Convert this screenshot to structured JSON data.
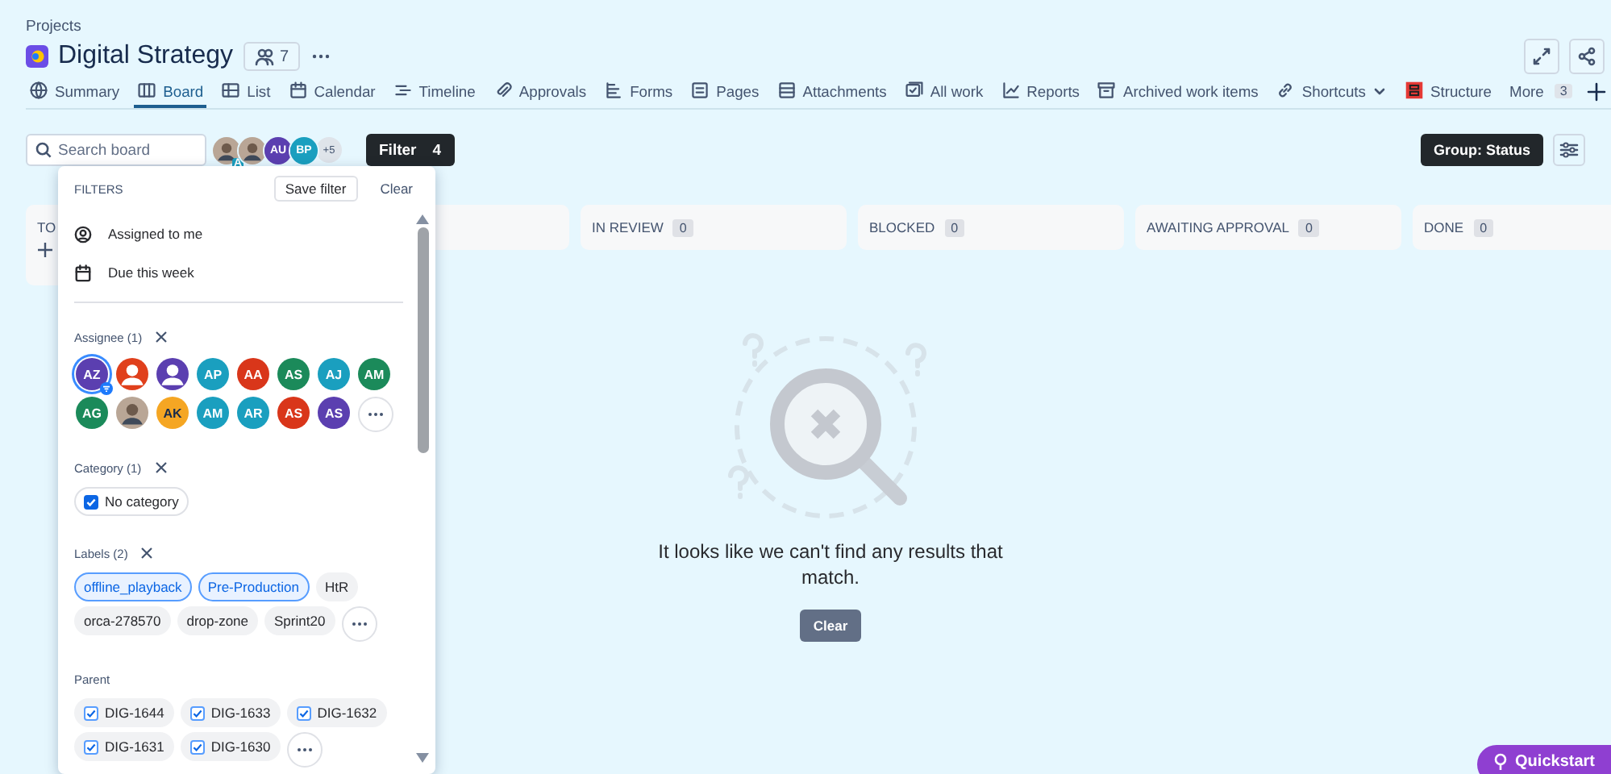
{
  "breadcrumb": "Projects",
  "project": {
    "title": "Digital Strategy",
    "members": "7"
  },
  "tabs": [
    {
      "label": "Summary",
      "selected": false
    },
    {
      "label": "Board",
      "selected": true
    },
    {
      "label": "List",
      "selected": false
    },
    {
      "label": "Calendar",
      "selected": false
    },
    {
      "label": "Timeline",
      "selected": false
    },
    {
      "label": "Approvals",
      "selected": false
    },
    {
      "label": "Forms",
      "selected": false
    },
    {
      "label": "Pages",
      "selected": false
    },
    {
      "label": "Attachments",
      "selected": false
    },
    {
      "label": "All work",
      "selected": false
    },
    {
      "label": "Reports",
      "selected": false
    },
    {
      "label": "Archived work items",
      "selected": false
    },
    {
      "label": "Shortcuts",
      "selected": false
    },
    {
      "label": "Structure",
      "selected": false
    },
    {
      "label": "More",
      "count": "3",
      "selected": false
    }
  ],
  "toolbar": {
    "search_placeholder": "Search board",
    "avatars": [
      {
        "kind": "photo",
        "badge": "A"
      },
      {
        "kind": "photo"
      },
      {
        "kind": "initials",
        "initials": "AU",
        "color": "#5b3fb0"
      },
      {
        "kind": "initials",
        "initials": "BP",
        "color": "#1a9fbf"
      }
    ],
    "more_avatars": "+5",
    "filter": {
      "label": "Filter",
      "count": "4"
    },
    "group_button": "Group: Status"
  },
  "columns": [
    {
      "label": "TO"
    },
    {
      "label": "IN REVIEW",
      "count": "0"
    },
    {
      "label": "BLOCKED",
      "count": "0"
    },
    {
      "label": "AWAITING APPROVAL",
      "count": "0"
    },
    {
      "label": "DONE",
      "count": "0"
    }
  ],
  "filters": {
    "title": "FILTERS",
    "save": "Save filter",
    "clear": "Clear",
    "quick": [
      {
        "label": "Assigned to me"
      },
      {
        "label": "Due this week"
      }
    ],
    "assignee": {
      "title": "Assignee (1)",
      "people": [
        {
          "kind": "initials",
          "initials": "AZ",
          "color": "#5b3fb0",
          "selected": true
        },
        {
          "kind": "silhouette",
          "color": "#e0401c",
          "selected": false
        },
        {
          "kind": "silhouette",
          "color": "#5b3fb0",
          "selected": false
        },
        {
          "kind": "initials",
          "initials": "AP",
          "color": "#1a9fbf",
          "selected": false
        },
        {
          "kind": "initials",
          "initials": "AA",
          "color": "#d9361a",
          "selected": false
        },
        {
          "kind": "initials",
          "initials": "AS",
          "color": "#1b8a5a",
          "selected": false
        },
        {
          "kind": "initials",
          "initials": "AJ",
          "color": "#1a9fbf",
          "selected": false
        },
        {
          "kind": "initials",
          "initials": "AM",
          "color": "#1b8a5a",
          "selected": false
        },
        {
          "kind": "initials",
          "initials": "AG",
          "color": "#1b8a5a",
          "selected": false
        },
        {
          "kind": "photo",
          "selected": false
        },
        {
          "kind": "initials",
          "initials": "AK",
          "color": "#f5a623",
          "selected": false
        },
        {
          "kind": "initials",
          "initials": "AM",
          "color": "#1a9fbf",
          "selected": false
        },
        {
          "kind": "initials",
          "initials": "AR",
          "color": "#1a9fbf",
          "selected": false
        },
        {
          "kind": "initials",
          "initials": "AS",
          "color": "#d9361a",
          "selected": false
        },
        {
          "kind": "initials",
          "initials": "AS",
          "color": "#5b3fb0",
          "selected": false
        }
      ]
    },
    "category": {
      "title": "Category (1)",
      "options": [
        {
          "label": "No category",
          "checked": true
        }
      ]
    },
    "labels": {
      "title": "Labels (2)",
      "items": [
        {
          "label": "offline_playback",
          "selected": true
        },
        {
          "label": "Pre-Production",
          "selected": true
        },
        {
          "label": "HtR",
          "selected": false
        },
        {
          "label": "orca-278570",
          "selected": false
        },
        {
          "label": "drop-zone",
          "selected": false
        },
        {
          "label": "Sprint20",
          "selected": false
        }
      ]
    },
    "parent": {
      "title": "Parent",
      "items": [
        {
          "label": "DIG-1644",
          "checked": true
        },
        {
          "label": "DIG-1633",
          "checked": true
        },
        {
          "label": "DIG-1632",
          "checked": true
        },
        {
          "label": "DIG-1631",
          "checked": true
        },
        {
          "label": "DIG-1630",
          "checked": true
        }
      ]
    }
  },
  "empty": {
    "message": "It looks like we can't find any results that match.",
    "clear": "Clear"
  },
  "quickstart": "Quickstart"
}
